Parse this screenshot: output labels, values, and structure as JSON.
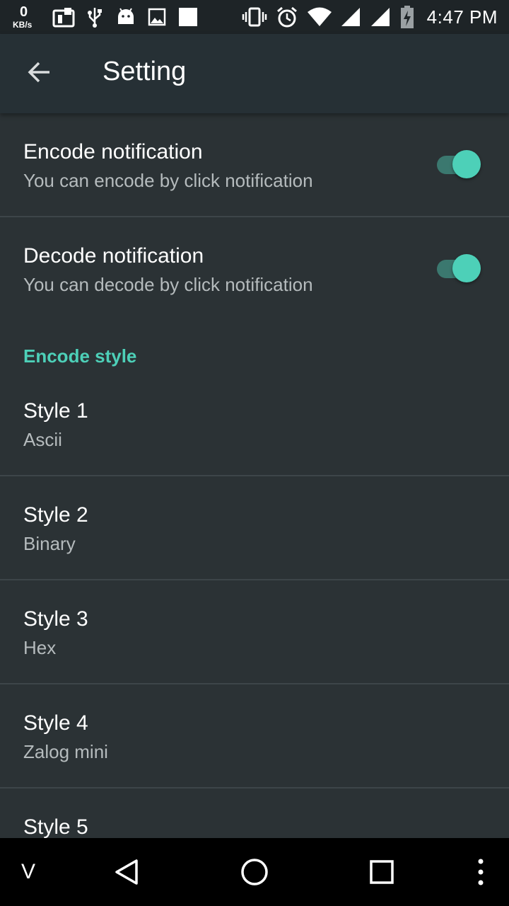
{
  "status_bar": {
    "net_speed_value": "0",
    "net_speed_unit": "KB/s",
    "time": "4:47 PM",
    "left_icons": [
      "sim-icon",
      "usb-icon",
      "android-icon",
      "image-icon",
      "square-icon"
    ],
    "right_icons": [
      "vibrate-icon",
      "alarm-icon",
      "wifi-icon",
      "signal-icon",
      "signal-icon",
      "battery-icon"
    ]
  },
  "app_bar": {
    "title": "Setting",
    "back_icon": "arrow-back-icon"
  },
  "preferences": {
    "encode_notification": {
      "title": "Encode notification",
      "summary": "You can encode by click notification",
      "enabled": true
    },
    "decode_notification": {
      "title": "Decode notification",
      "summary": "You can decode by click notification",
      "enabled": true
    }
  },
  "encode_style": {
    "header": "Encode style",
    "items": [
      {
        "title": "Style 1",
        "summary": "Ascii"
      },
      {
        "title": "Style 2",
        "summary": "Binary"
      },
      {
        "title": "Style 3",
        "summary": "Hex"
      },
      {
        "title": "Style 4",
        "summary": "Zalog mini"
      },
      {
        "title": "Style 5",
        "summary": ""
      }
    ]
  },
  "nav_bar": {
    "v_label": "V",
    "icons": [
      "back-triangle-icon",
      "home-circle-icon",
      "recents-square-icon",
      "overflow-menu-icon"
    ]
  },
  "colors": {
    "accent": "#4dd0b8",
    "background": "#2b3235",
    "app_bar": "#263035"
  }
}
